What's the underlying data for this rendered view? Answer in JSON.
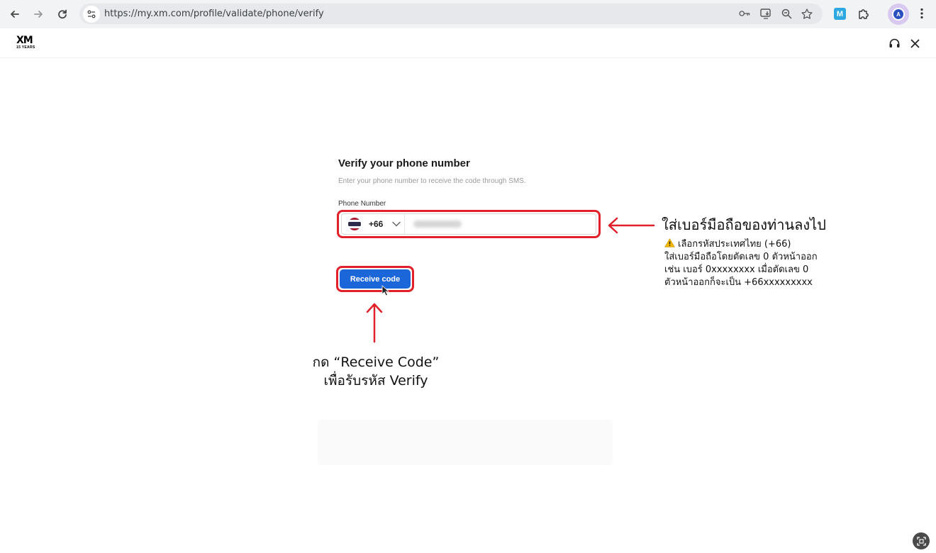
{
  "browser": {
    "url": "https://my.xm.com/profile/validate/phone/verify",
    "icons": [
      "back-icon",
      "forward-icon",
      "reload-icon",
      "site-info-icon",
      "password-key-icon",
      "install-app-icon",
      "zoom-icon",
      "bookmark-star-icon",
      "extension-m-icon",
      "puzzle-extensions-icon",
      "profile-avatar",
      "kebab-menu-icon"
    ],
    "extension_label": "M",
    "avatar_letter": "A"
  },
  "header": {
    "logo_text": "XM",
    "logo_sub": "15 YEARS",
    "icons": [
      "headset-support-icon",
      "close-icon"
    ]
  },
  "form": {
    "title": "Verify your phone number",
    "subtitle": "Enter your phone number to receive the code through SMS.",
    "phone_label": "Phone Number",
    "country_code": "+66",
    "phone_value": "",
    "receive_button": "Receive code"
  },
  "annotations": {
    "main": "ใส่เบอร์มือถือของท่านลงไป",
    "lines": [
      "เลือกรหัสประเทศไทย (+66)",
      "ใส่เบอร์มือถือโดยตัดเลข 0 ตัวหน้าออก",
      "เช่น เบอร์ 0xxxxxxxx เมื่อตัดเลข 0",
      "ตัวหน้าออกก็จะเป็น +66xxxxxxxxx"
    ],
    "bottom_line1": "กด “Receive Code”",
    "bottom_line2": "เพื่อรับรหัส Verify"
  },
  "colors": {
    "accent_red": "#e0202a",
    "button_blue": "#1b66d9",
    "flag": [
      "#a51931",
      "#f4f5f8",
      "#2d2a4a",
      "#f4f5f8",
      "#a51931"
    ]
  }
}
